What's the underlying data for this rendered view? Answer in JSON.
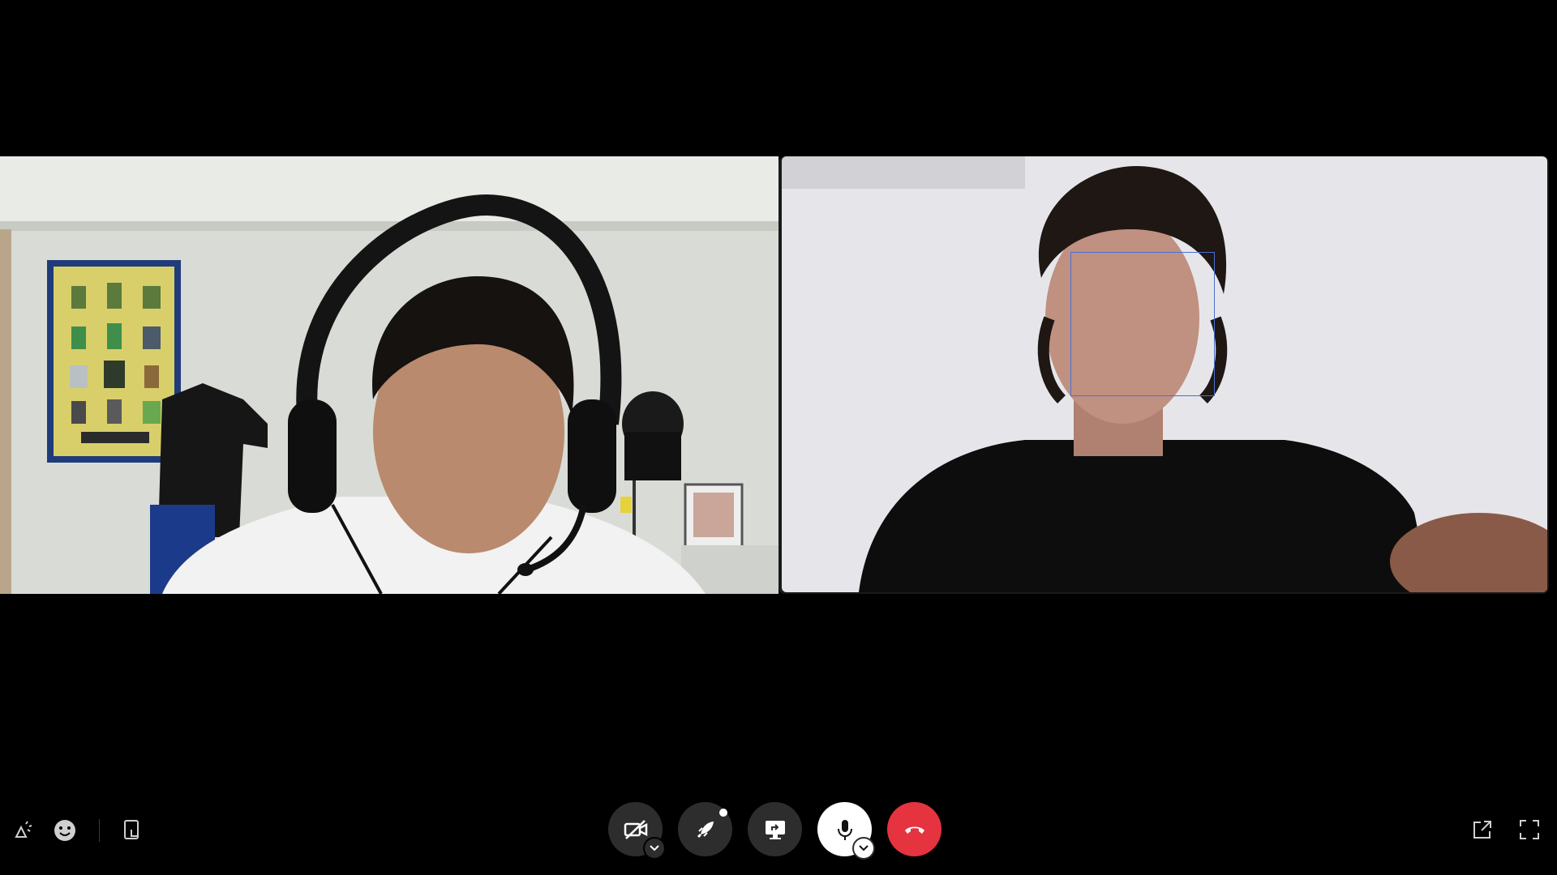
{
  "participants": [
    {
      "id": "participant-1",
      "position": "left"
    },
    {
      "id": "participant-2",
      "position": "right",
      "face_detected": true
    }
  ],
  "toolbar_left": [
    {
      "name": "reactions-icon",
      "label": ""
    },
    {
      "name": "emoji-icon",
      "label": ""
    },
    {
      "name": "hand-raise-icon",
      "label": ""
    }
  ],
  "toolbar_center": [
    {
      "name": "camera-off-button",
      "has_caret": true
    },
    {
      "name": "rocket-button",
      "has_notification": true
    },
    {
      "name": "share-screen-button"
    },
    {
      "name": "microphone-button",
      "has_caret": true,
      "state": "on"
    },
    {
      "name": "hang-up-button"
    }
  ],
  "toolbar_right": [
    {
      "name": "pop-out-icon"
    },
    {
      "name": "fullscreen-icon"
    }
  ],
  "colors": {
    "background": "#000000",
    "button_dark": "#2d2d2d",
    "hangup": "#e5333f",
    "mic_active": "#ffffff",
    "face_box": "#4a6fd0"
  }
}
